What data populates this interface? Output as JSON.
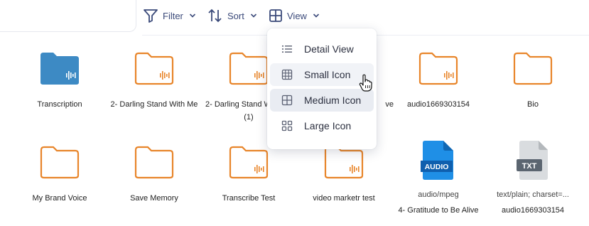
{
  "toolbar": {
    "filter_label": "Filter",
    "sort_label": "Sort",
    "view_label": "View"
  },
  "view_menu": {
    "items": [
      {
        "label": "Detail View",
        "icon": "list-icon"
      },
      {
        "label": "Small Icon",
        "icon": "small-grid-icon"
      },
      {
        "label": "Medium Icon",
        "icon": "medium-grid-icon"
      },
      {
        "label": "Large Icon",
        "icon": "large-grid-icon"
      }
    ],
    "hovered": "Small Icon",
    "selected": "Medium Icon"
  },
  "files": [
    {
      "name": "Transcription",
      "kind": "folder-filled"
    },
    {
      "name": "2- Darling Stand With Me",
      "kind": "folder-audio"
    },
    {
      "name": "2- Darling Stand W",
      "name_line2": "(1)",
      "kind": "folder-audio"
    },
    {
      "name": "ve",
      "kind": "hidden"
    },
    {
      "name": "audio1669303154",
      "kind": "folder-audio"
    },
    {
      "name": "Bio",
      "kind": "folder"
    },
    {
      "name": "My Brand Voice",
      "kind": "folder"
    },
    {
      "name": "Save Memory",
      "kind": "folder"
    },
    {
      "name": "Transcribe Test",
      "kind": "folder-audio"
    },
    {
      "name": "video marketr test",
      "kind": "folder-audio"
    },
    {
      "type": "audio/mpeg",
      "name": "4- Gratitude to Be Alive",
      "kind": "audio-file",
      "badge": "AUDIO"
    },
    {
      "type": "text/plain; charset=...",
      "name": "audio1669303154",
      "kind": "txt-file",
      "badge": "TXT"
    }
  ],
  "colors": {
    "folder_orange": "#e8852a",
    "folder_blue": "#3d8ac4",
    "audio_blue": "#1f8fe6",
    "txt_grey": "#d9dcdf",
    "accent": "#3b4a7a"
  }
}
